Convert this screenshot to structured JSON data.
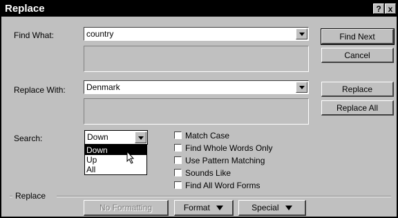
{
  "window": {
    "title": "Replace",
    "help_glyph": "?",
    "close_glyph": "x"
  },
  "find": {
    "label": "Find What:",
    "value": "country"
  },
  "replace_field": {
    "label": "Replace With:",
    "value": "Denmark"
  },
  "search": {
    "label": "Search:",
    "value": "Down",
    "options": [
      "Down",
      "Up",
      "All"
    ],
    "highlighted": "Down"
  },
  "options": [
    {
      "label": "Match Case",
      "checked": false
    },
    {
      "label": "Find Whole Words Only",
      "checked": false
    },
    {
      "label": "Use Pattern Matching",
      "checked": false
    },
    {
      "label": "Sounds Like",
      "checked": false
    },
    {
      "label": "Find All Word Forms",
      "checked": false
    }
  ],
  "group": {
    "label": "Replace"
  },
  "buttons": {
    "find_next": "Find Next",
    "cancel": "Cancel",
    "replace": "Replace",
    "replace_all": "Replace All",
    "no_formatting": "No Formatting",
    "format": "Format",
    "special": "Special"
  },
  "icons": {
    "dropdown": "chevron-down-icon",
    "cursor": "mouse-pointer-icon"
  }
}
